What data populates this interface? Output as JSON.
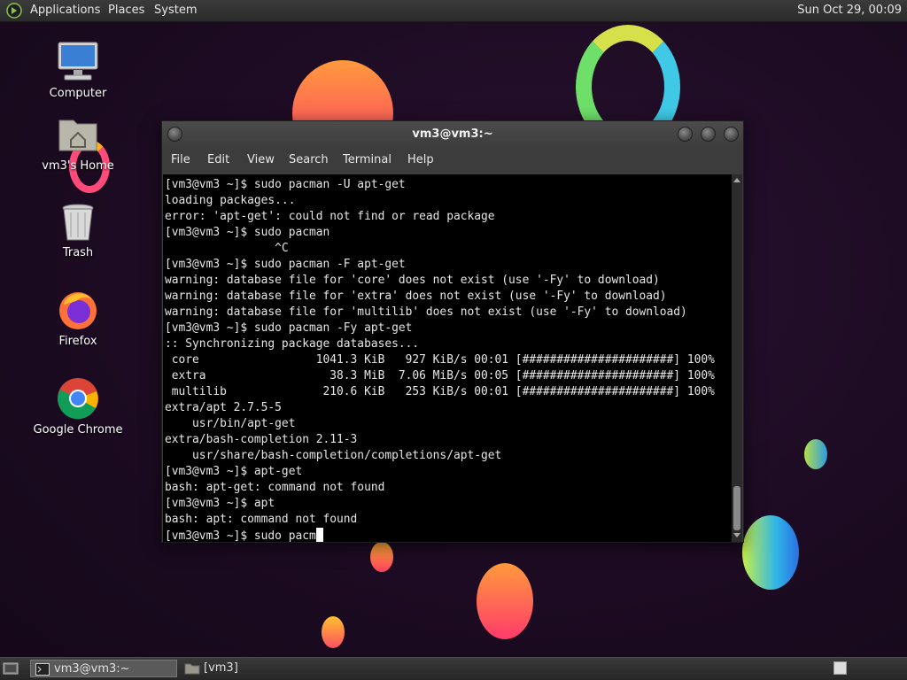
{
  "top_panel": {
    "menus": [
      "Applications",
      "Places",
      "System"
    ],
    "clock": "Sun Oct 29, 00:09"
  },
  "desktop_icons": [
    {
      "label": "Computer",
      "icon": "computer-icon"
    },
    {
      "label": "vm3's Home",
      "icon": "home-folder-icon"
    },
    {
      "label": "Trash",
      "icon": "trash-icon"
    },
    {
      "label": "Firefox",
      "icon": "firefox-icon"
    },
    {
      "label": "Google Chrome",
      "icon": "chrome-icon"
    }
  ],
  "terminal": {
    "title": "vm3@vm3:~",
    "menus": [
      "File",
      "Edit",
      "View",
      "Search",
      "Terminal",
      "Help"
    ],
    "lines": [
      "[vm3@vm3 ~]$ sudo pacman -U apt-get",
      "loading packages...",
      "error: 'apt-get': could not find or read package",
      "[vm3@vm3 ~]$ sudo pacman",
      "                ^C",
      "[vm3@vm3 ~]$ sudo pacman -F apt-get",
      "warning: database file for 'core' does not exist (use '-Fy' to download)",
      "warning: database file for 'extra' does not exist (use '-Fy' to download)",
      "warning: database file for 'multilib' does not exist (use '-Fy' to download)",
      "[vm3@vm3 ~]$ sudo pacman -Fy apt-get",
      ":: Synchronizing package databases...",
      " core                 1041.3 KiB   927 KiB/s 00:01 [######################] 100%",
      " extra                  38.3 MiB  7.06 MiB/s 00:05 [######################] 100%",
      " multilib              210.6 KiB   253 KiB/s 00:01 [######################] 100%",
      "extra/apt 2.7.5-5",
      "    usr/bin/apt-get",
      "extra/bash-completion 2.11-3",
      "    usr/share/bash-completion/completions/apt-get",
      "[vm3@vm3 ~]$ apt-get",
      "bash: apt-get: command not found",
      "[vm3@vm3 ~]$ apt",
      "bash: apt: command not found"
    ],
    "prompt_line": "[vm3@vm3 ~]$ sudo pacm"
  },
  "taskbar": {
    "items": [
      {
        "label": "vm3@vm3:~",
        "icon": "terminal-icon",
        "active": true
      },
      {
        "label": "[vm3]",
        "icon": "folder-icon",
        "active": false
      }
    ]
  },
  "colors": {
    "desktop_bg": "#1c0b22",
    "panel_bg": "#333333",
    "terminal_bg": "#000000",
    "terminal_fg": "#e6e6e6"
  }
}
